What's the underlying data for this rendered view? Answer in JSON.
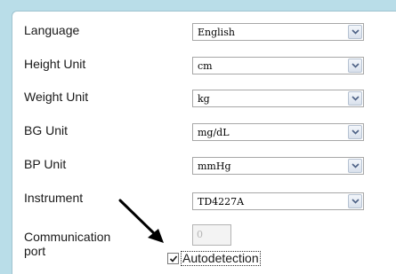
{
  "settings": {
    "rows": [
      {
        "label": "Language",
        "value": "English"
      },
      {
        "label": "Height Unit",
        "value": "cm"
      },
      {
        "label": "Weight Unit",
        "value": "kg"
      },
      {
        "label": "BG Unit",
        "value": "mg/dL"
      },
      {
        "label": "BP Unit",
        "value": "mmHg"
      },
      {
        "label": "Instrument",
        "value": "TD4227A"
      }
    ],
    "port": {
      "label_line1": "Communication",
      "label_line2": "port",
      "value": "0",
      "autodetect_label": "Autodetection",
      "autodetect_checked": true
    }
  },
  "icons": {
    "dropdown": "chevron-down-icon",
    "annotation": "arrow-pointer-icon",
    "check": "check-icon"
  },
  "colors": {
    "background": "#b9dde8",
    "panel": "#ffffff",
    "arrow": "#000000"
  }
}
